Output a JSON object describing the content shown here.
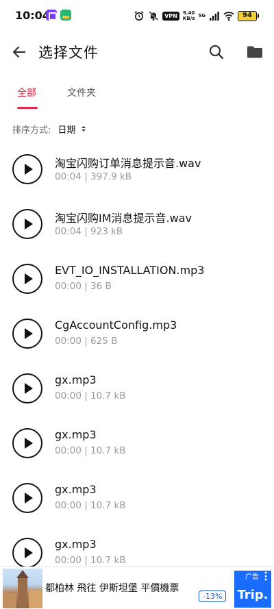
{
  "status_bar": {
    "time": "10:04",
    "vpn": "VPN",
    "net_speed_value": "9.40",
    "net_speed_unit": "KB/s",
    "network": "5G",
    "battery": "94"
  },
  "header": {
    "title": "选择文件"
  },
  "tabs": [
    {
      "label": "全部",
      "active": true
    },
    {
      "label": "文件夹",
      "active": false
    }
  ],
  "sort": {
    "label": "排序方式:",
    "value": "日期"
  },
  "files": [
    {
      "name": "淘宝闪购订单消息提示音.wav",
      "meta": "00:04 | 397.9 kB"
    },
    {
      "name": "淘宝闪购IM消息提示音.wav",
      "meta": "00:04 | 923 kB"
    },
    {
      "name": "EVT_IO_INSTALLATION.mp3",
      "meta": "00:00 | 36 B"
    },
    {
      "name": "CgAccountConfig.mp3",
      "meta": "00:00 | 625 B"
    },
    {
      "name": "gx.mp3",
      "meta": "00:00 | 10.7 kB"
    },
    {
      "name": "gx.mp3",
      "meta": "00:00 | 10.7 kB"
    },
    {
      "name": "gx.mp3",
      "meta": "00:00 | 10.7 kB"
    },
    {
      "name": "gx.mp3",
      "meta": "00:00 | 10.7 kB"
    }
  ],
  "ad": {
    "text": "都柏林 飛往 伊斯坦堡 平價機票",
    "discount": "-13%",
    "tag": "广告",
    "brand": "Trip."
  },
  "colors": {
    "accent": "#e0284a",
    "ad_brand": "#1a6cff"
  }
}
